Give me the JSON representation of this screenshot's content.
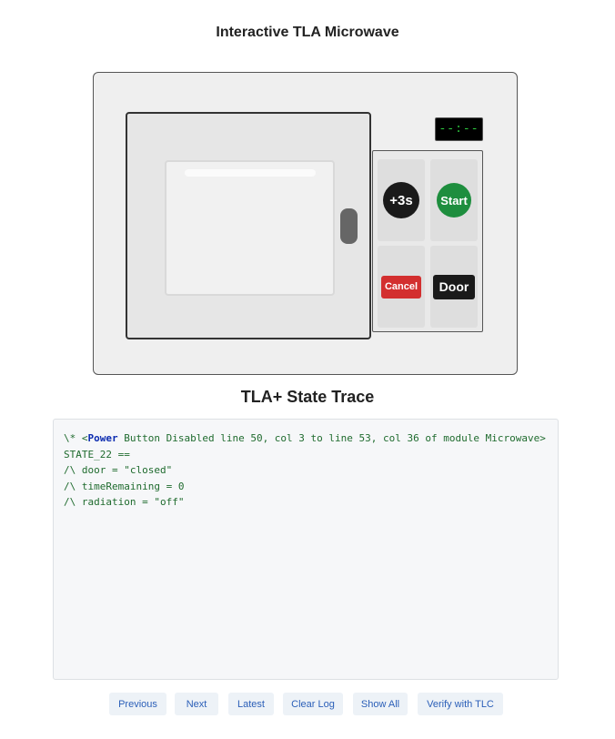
{
  "page": {
    "title": "Interactive TLA Microwave"
  },
  "microwave": {
    "display": "--:--",
    "buttons": {
      "plus3": "+3s",
      "start": "Start",
      "cancel": "Cancel",
      "door": "Door"
    }
  },
  "trace": {
    "title": "TLA+ State Trace",
    "comment_prefix": "\\* <",
    "action_name": "Power",
    "comment_rest": " Button Disabled line 50, col 3 to line 53, col 36 of module Microwave>",
    "lines": [
      "STATE_22 ==",
      "/\\ door = \"closed\"",
      "/\\ timeRemaining = 0",
      "/\\ radiation = \"off\""
    ]
  },
  "nav": {
    "previous": "Previous",
    "next": "Next",
    "latest": "Latest",
    "clear_log": "Clear Log",
    "show_all": "Show All",
    "verify": "Verify with TLC"
  },
  "colors": {
    "start_button": "#1e8e3e",
    "cancel_button": "#d32f2f",
    "display_text": "#2ecc40",
    "nav_text": "#2b5fb8",
    "trace_keyword": "#0b2bb0",
    "trace_text": "#1f6b2e"
  }
}
